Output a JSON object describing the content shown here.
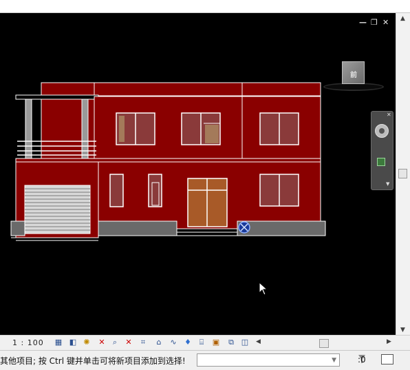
{
  "window": {
    "minimize_glyph": "—",
    "restore_glyph": "❐",
    "close_glyph": "✕"
  },
  "viewcube": {
    "face_label": "前"
  },
  "colors": {
    "background": "#000000",
    "wall": "#8a0000",
    "wall_outline": "#ffffff",
    "door": "#a85a28",
    "window_glass": "#8a3a3a",
    "plinth": "#6a6a6a"
  },
  "view_bar": {
    "scale": "1 : 100",
    "icons": [
      "detail-level-icon",
      "visual-style-icon",
      "sun-path-icon",
      "shadows-icon",
      "rendering-icon",
      "crop-view-icon",
      "show-crop-icon",
      "temporary-hide-icon",
      "reveal-hidden-icon",
      "worksharing-icon",
      "analytical-model-icon",
      "highlight-displacement-icon",
      "reveal-constraints-icon",
      "temporary-view-icon"
    ]
  },
  "status_bar": {
    "message": "其他项目; 按 Ctrl 键并单击可将新项目添加到选择!",
    "combo_value": "",
    "filter_count": ":0"
  }
}
